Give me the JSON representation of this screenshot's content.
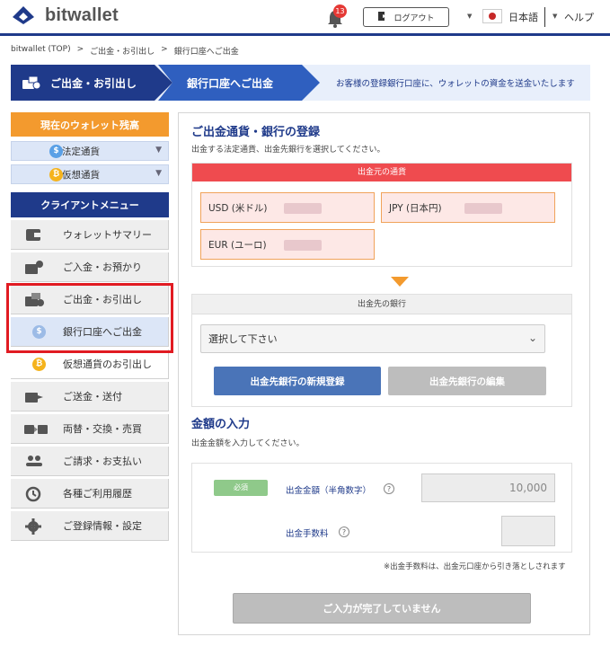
{
  "header": {
    "logo_text": "bitwallet",
    "notification_count": "13",
    "logout_label": "ログアウト",
    "language_label": "日本語",
    "help_label": "ヘルプ",
    "icons": [
      "logo-mark",
      "bell-icon",
      "logout-icon",
      "flag-icon"
    ]
  },
  "breadcrumb": {
    "items": [
      "bitwallet (TOP)",
      "ご出金・お引出し",
      "銀行口座へご出金"
    ],
    "separator": ">"
  },
  "banner": {
    "step1": "ご出金・お引出し",
    "step2": "銀行口座へご出金",
    "description": "お客様の登録銀行口座に、ウォレットの資金を送金いたします"
  },
  "sidebar": {
    "balance_heading": "現在のウォレット残高",
    "balances": [
      {
        "label": "法定通貨",
        "icon": "dollar-coin-icon"
      },
      {
        "label": "仮想通貨",
        "icon": "bitcoin-coin-icon"
      }
    ],
    "menu_heading": "クライアントメニュー",
    "items": [
      {
        "label": "ウォレットサマリー",
        "icon": "wallet-icon"
      },
      {
        "label": "ご入金・お預かり",
        "icon": "deposit-icon"
      },
      {
        "label": "ご出金・お引出し",
        "icon": "withdraw-icon"
      },
      {
        "label": "銀行口座へご出金",
        "icon": "dollar-coin-icon"
      },
      {
        "label": "仮想通貨のお引出し",
        "icon": "bitcoin-coin-icon"
      },
      {
        "label": "ご送金・送付",
        "icon": "send-icon"
      },
      {
        "label": "両替・交換・売買",
        "icon": "exchange-icon"
      },
      {
        "label": "ご請求・お支払い",
        "icon": "users-icon"
      },
      {
        "label": "各種ご利用履歴",
        "icon": "history-icon"
      },
      {
        "label": "ご登録情報・設定",
        "icon": "gear-icon"
      }
    ]
  },
  "main": {
    "currency_section": {
      "title": "ご出金通貨・銀行の登録",
      "description": "出金する法定通貨、出金先銀行を選択してください。",
      "source_heading": "出金元の通貨",
      "currencies": [
        "USD (米ドル)",
        "JPY (日本円)",
        "EUR (ユーロ)"
      ]
    },
    "bank_section": {
      "heading": "出金先の銀行",
      "select_value": "選択して下さい",
      "register_button": "出金先銀行の新規登録",
      "edit_button": "出金先銀行の編集"
    },
    "amount_section": {
      "title": "金額の入力",
      "description": "出金金額を入力してください。",
      "required_badge": "必須",
      "amount_label": "出金金額（半角数字）",
      "amount_placeholder": "10,000",
      "fee_label": "出金手数料",
      "fee_note": "※出金手数料は、出金元口座から引き落としされます"
    },
    "submit_label": "ご入力が完了していません"
  },
  "colors": {
    "navy": "#1f3a8a",
    "orange": "#f39a2e",
    "red_head": "#ef4b4f",
    "highlight": "#e11b22",
    "blue_button": "#4a74b8"
  }
}
